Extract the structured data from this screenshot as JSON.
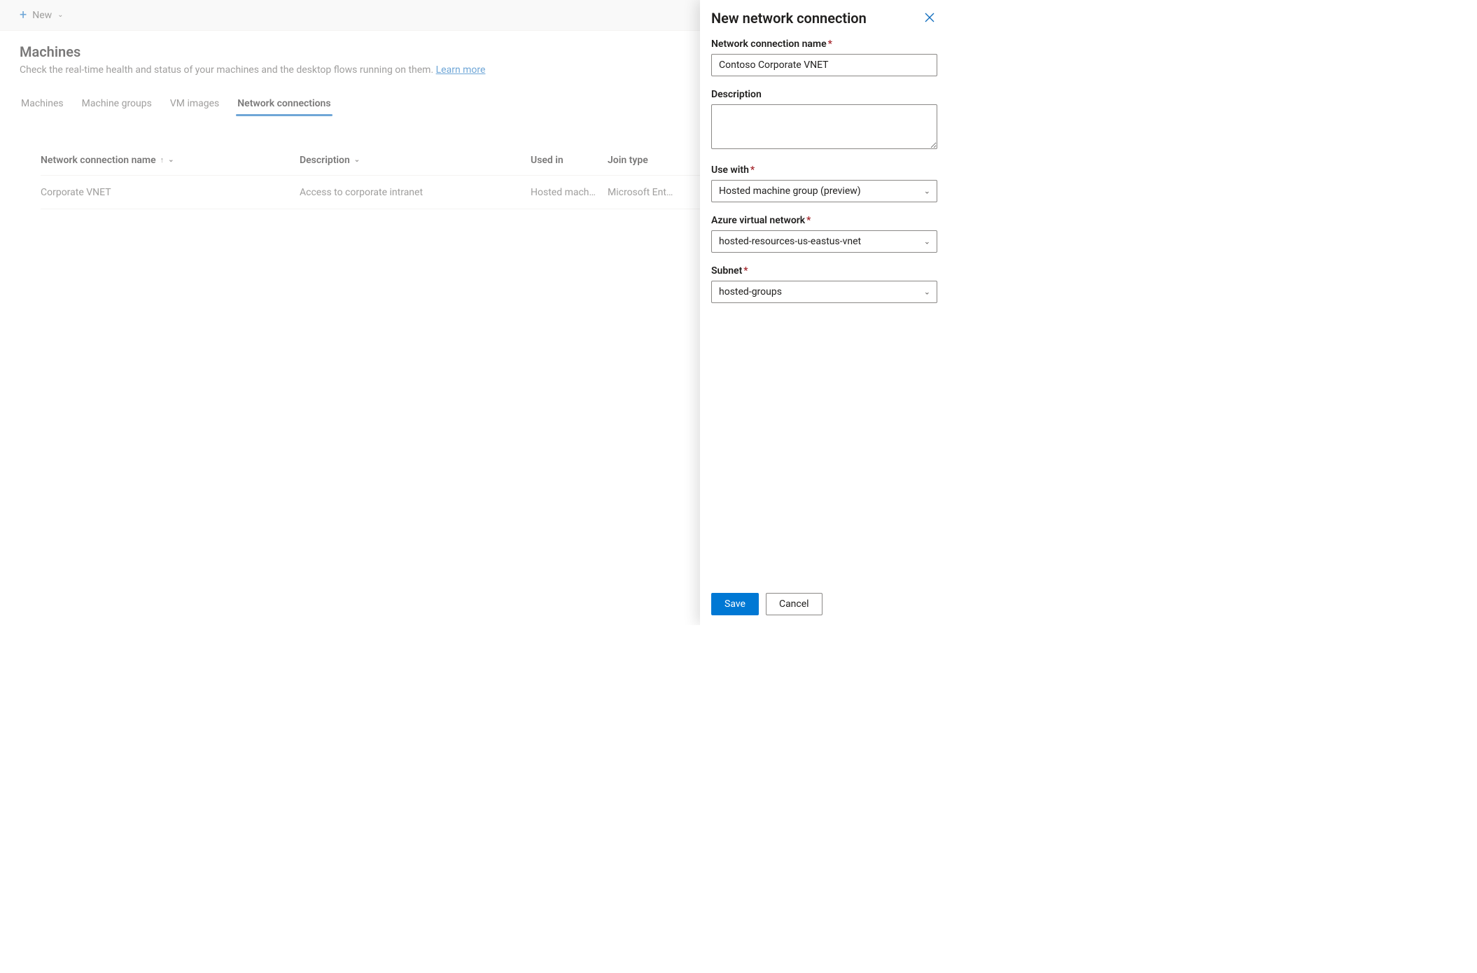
{
  "toolbar": {
    "new_label": "New"
  },
  "page": {
    "title": "Machines",
    "subtitle_prefix": "Check the real-time health and status of your machines and the desktop flows running on them. ",
    "learn_more": "Learn more"
  },
  "tabs": [
    {
      "label": "Machines",
      "active": false
    },
    {
      "label": "Machine groups",
      "active": false
    },
    {
      "label": "VM images",
      "active": false
    },
    {
      "label": "Network connections",
      "active": true
    }
  ],
  "table": {
    "columns": {
      "name": "Network connection name",
      "description": "Description",
      "used_in": "Used in",
      "join_type": "Join type"
    },
    "rows": [
      {
        "name": "Corporate VNET",
        "description": "Access to corporate intranet",
        "used_in": "Hosted mach…",
        "join_type": "Microsoft Ent…"
      }
    ]
  },
  "panel": {
    "title": "New network connection",
    "fields": {
      "name_label": "Network connection name",
      "name_value": "Contoso Corporate VNET",
      "description_label": "Description",
      "description_value": "",
      "use_with_label": "Use with",
      "use_with_value": "Hosted machine group (preview)",
      "vnet_label": "Azure virtual network",
      "vnet_value": "hosted-resources-us-eastus-vnet",
      "subnet_label": "Subnet",
      "subnet_value": "hosted-groups"
    },
    "save_label": "Save",
    "cancel_label": "Cancel"
  }
}
